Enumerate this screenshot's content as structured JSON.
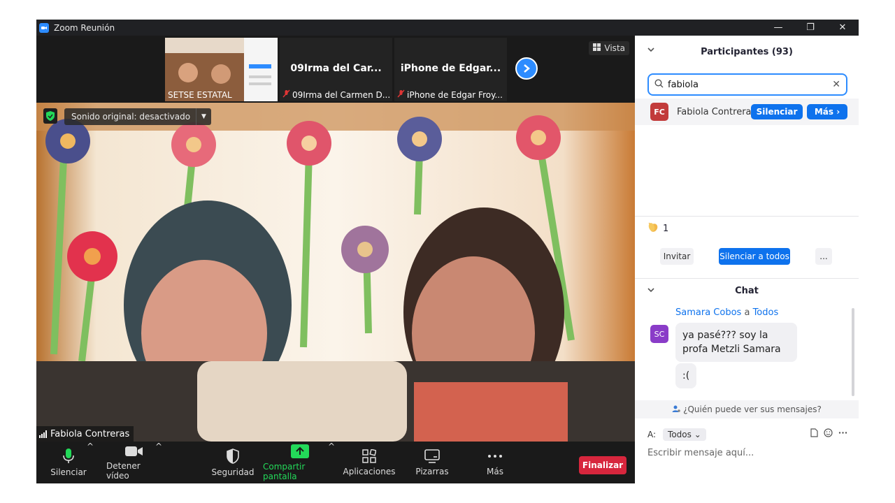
{
  "window": {
    "title": "Zoom Reunión",
    "minimize": "—",
    "restore": "❐",
    "close": "✕"
  },
  "thumbnails": [
    {
      "name": "",
      "label": "SETSE ESTATAL",
      "muted": false
    },
    {
      "name": "09Irma del Car...",
      "label": "09Irma del Carmen D...",
      "muted": true
    },
    {
      "name": "iPhone de Edgar...",
      "label": "iPhone de Edgar Froy...",
      "muted": true
    }
  ],
  "view_button": "Vista",
  "main_video": {
    "sound_label": "Sonido original: desactivado",
    "speaker": "Fabiola Contreras"
  },
  "toolbar": {
    "mute": "Silenciar",
    "video": "Detener vídeo",
    "security": "Seguridad",
    "share": "Compartir pantalla",
    "apps": "Aplicaciones",
    "whiteboards": "Pizarras",
    "more": "Más",
    "end": "Finalizar"
  },
  "participants": {
    "title": "Participantes (93)",
    "search_value": "fabiola",
    "result": {
      "initials": "FC",
      "name": "Fabiola Contreras",
      "mute_button": "Silenciar",
      "more_button": "Más ›"
    },
    "reaction_count": "1",
    "invite": "Invitar",
    "mute_all": "Silenciar a todos",
    "more": "..."
  },
  "chat": {
    "title": "Chat",
    "sender": "Samara Cobos",
    "to_word": "a",
    "recipient": "Todos",
    "avatar_initials": "SC",
    "messages": [
      "ya pasé??? soy la profa Metzli Samara",
      ":("
    ],
    "who_can_see": "¿Quién puede ver sus mensajes?",
    "to_label": "A:",
    "to_select": "Todos",
    "placeholder": "Escribir mensaje aquí..."
  },
  "colors": {
    "accent": "#0e72ed",
    "end": "#d7263d",
    "share": "#23d959"
  }
}
